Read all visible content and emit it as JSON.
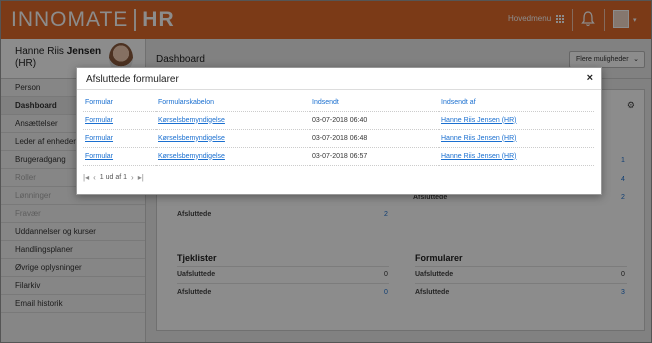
{
  "app": {
    "logo_left": "INNOMATE",
    "logo_right": "HR",
    "main_menu": "Hovedmenu"
  },
  "user": {
    "first": "Hanne Riis ",
    "last": "Jensen",
    "suffix": "(HR)"
  },
  "sidebar": {
    "items": [
      {
        "label": "Person"
      },
      {
        "label": "Dashboard"
      },
      {
        "label": "Ansættelser"
      },
      {
        "label": "Leder af enheder"
      },
      {
        "label": "Brugeradgang"
      },
      {
        "label": "Roller"
      },
      {
        "label": "Lønninger"
      },
      {
        "label": "Fravær"
      },
      {
        "label": "Uddannelser og kurser"
      },
      {
        "label": "Handlingsplaner"
      },
      {
        "label": "Øvrige oplysninger"
      },
      {
        "label": "Filarkiv"
      },
      {
        "label": "Email historik"
      }
    ]
  },
  "content": {
    "title": "Dashboard",
    "more_button": "Flere muligheder",
    "bg_rows": [
      {
        "label": "Afsluttede",
        "value": "2"
      }
    ],
    "bg_right_vals": [
      "1",
      "4",
      "2"
    ],
    "bg_partial_label": "Afsluttede",
    "tjeklister": {
      "title": "Tjeklister",
      "rows": [
        {
          "label": "Uafsluttede",
          "value": "0"
        },
        {
          "label": "Afsluttede",
          "value": "0"
        }
      ]
    },
    "formularer": {
      "title": "Formularer",
      "rows": [
        {
          "label": "Uafsluttede",
          "value": "0"
        },
        {
          "label": "Afsluttede",
          "value": "3"
        }
      ]
    }
  },
  "modal": {
    "title": "Afsluttede formularer",
    "close": "×",
    "columns": [
      "Formular",
      "Formularskabelon",
      "Indsendt",
      "Indsendt af"
    ],
    "rows": [
      [
        "Formular",
        "Kørselsbemyndigelse",
        "03-07-2018 06:40",
        "Hanne Riis Jensen (HR)"
      ],
      [
        "Formular",
        "Kørselsbemyndigelse",
        "03-07-2018 06:48",
        "Hanne Riis Jensen (HR)"
      ],
      [
        "Formular",
        "Kørselsbemyndigelse",
        "03-07-2018 06:57",
        "Hanne Riis Jensen (HR)"
      ]
    ],
    "pager": {
      "first": "|◂",
      "prev": "‹",
      "text": "1 ud af 1",
      "next": "›",
      "last": "▸|"
    }
  },
  "colors": {
    "brand": "#e06a2b",
    "link": "#1a6fd0"
  }
}
